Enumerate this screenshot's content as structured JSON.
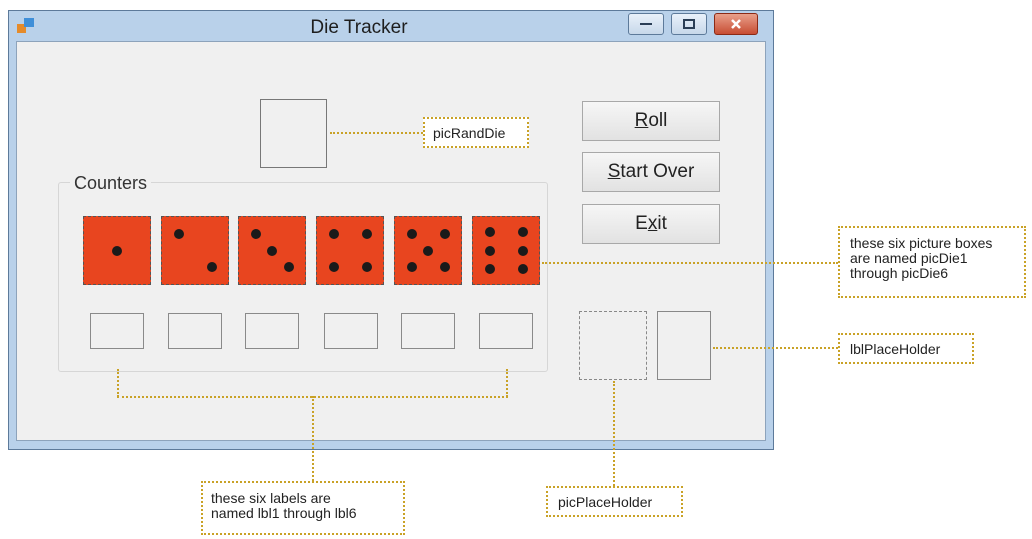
{
  "window": {
    "title": "Die Tracker"
  },
  "buttons": {
    "roll": {
      "accel": "R",
      "rest": "oll"
    },
    "start_over": {
      "accel": "S",
      "rest": "tart Over"
    },
    "exit": {
      "pre": "E",
      "accel": "x",
      "rest": "it"
    }
  },
  "group": {
    "label": "Counters"
  },
  "dice": [
    {
      "name": "die-1",
      "pips": 1
    },
    {
      "name": "die-2",
      "pips": 2
    },
    {
      "name": "die-3",
      "pips": 3
    },
    {
      "name": "die-4",
      "pips": 4
    },
    {
      "name": "die-5",
      "pips": 5
    },
    {
      "name": "die-6",
      "pips": 6
    }
  ],
  "callouts": {
    "pic_rand_die": "picRandDie",
    "picture_boxes": [
      "these six picture boxes",
      "are named picDie1",
      "through picDie6"
    ],
    "lbl_place_holder": "lblPlaceHolder",
    "labels": [
      "these six labels are",
      "named lbl1 through lbl6"
    ],
    "pic_place_holder": "picPlaceHolder"
  },
  "colors": {
    "die_face": "#e8451f",
    "pip": "#1a1a1a",
    "callout_border": "#c9a227"
  }
}
